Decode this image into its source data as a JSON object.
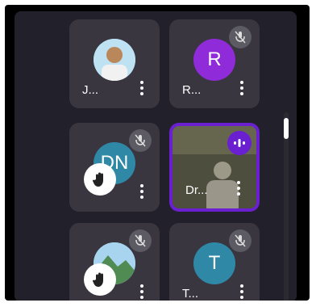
{
  "tiles": [
    {
      "name": "J...",
      "type": "photo"
    },
    {
      "name": "R...",
      "initials": "R",
      "color": "#8f2bd8"
    },
    {
      "name": "",
      "initials": "DN",
      "color": "#2f88a6"
    },
    {
      "name": "Dr...",
      "type": "video"
    },
    {
      "name": "",
      "type": "photo"
    },
    {
      "name": "T...",
      "initials": "T",
      "color": "#2f88a6"
    }
  ],
  "icons": {
    "mute": "mic-off-icon",
    "hand": "raised-hand-icon",
    "more": "more-vert-icon",
    "speaking": "audio-level-icon"
  }
}
